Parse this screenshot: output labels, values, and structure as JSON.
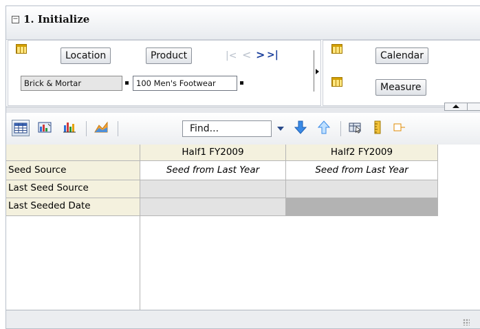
{
  "panel": {
    "title": "1. Initialize",
    "collapse_symbol": "−"
  },
  "page_edge": {
    "left": {
      "dimensions": [
        "Location",
        "Product"
      ],
      "nav": {
        "first": "|<",
        "prev": "<",
        "next": ">",
        "last": ">|"
      },
      "selections": [
        "Brick & Mortar",
        "100 Men's Footwear"
      ]
    },
    "right": {
      "dimensions": [
        "Calendar",
        "Measure"
      ]
    }
  },
  "toolbar": {
    "find_placeholder": "Find..."
  },
  "grid": {
    "columns": [
      "Half1 FY2009",
      "Half2 FY2009"
    ],
    "rows": [
      {
        "label": "Seed Source",
        "values": [
          "Seed from Last Year",
          "Seed from Last Year"
        ]
      },
      {
        "label": "Last Seed Source",
        "values": [
          "",
          ""
        ]
      },
      {
        "label": "Last Seeded Date",
        "values": [
          "",
          ""
        ]
      }
    ]
  },
  "colors": {
    "header_bg": "#f4f1de",
    "panel_border": "#b7bfca",
    "arrow_blue": "#2f7fe0"
  }
}
